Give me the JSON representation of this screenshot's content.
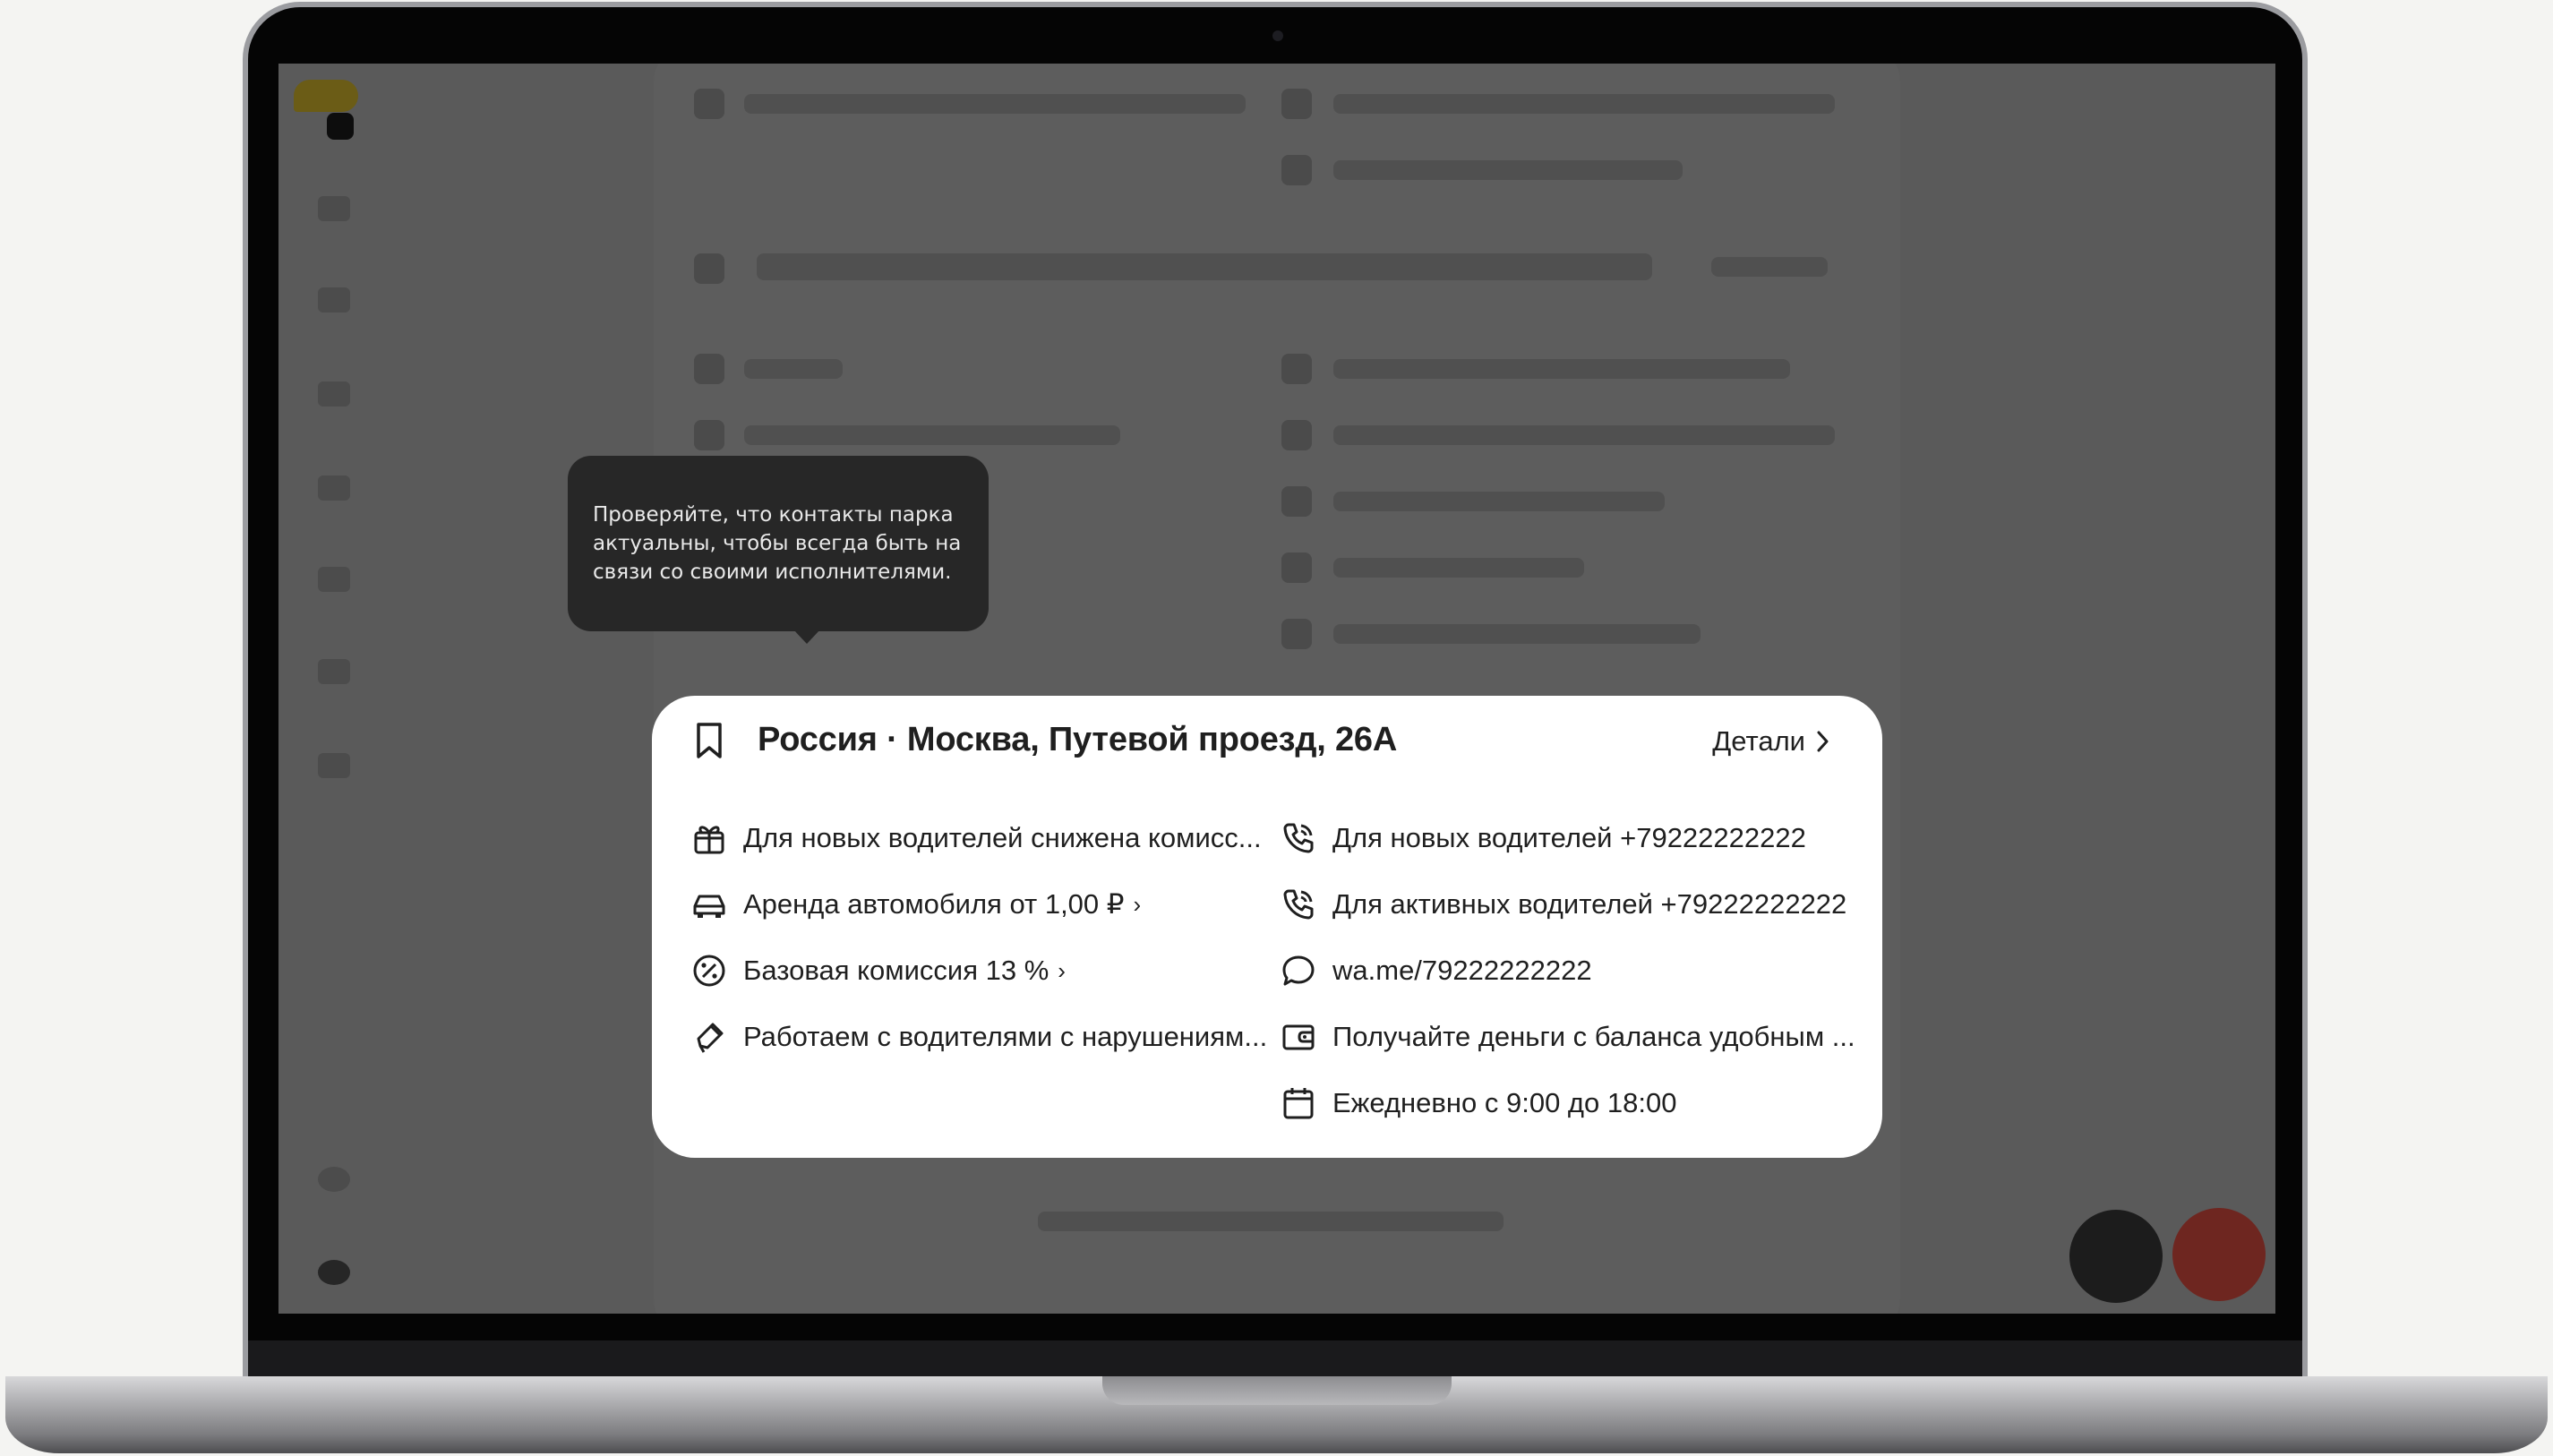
{
  "tooltip": {
    "lines": [
      "Проверяйте, что контакты парка",
      "актуальны, чтобы всегда быть на",
      "связи со своими исполнителями."
    ]
  },
  "card": {
    "title": "Россия · Москва, Путевой проезд, 26А",
    "details_label": "Детали",
    "left_items": [
      {
        "icon": "gift-icon",
        "text": "Для новых водителей снижена комисс...",
        "chevron": ""
      },
      {
        "icon": "car-icon",
        "text": "Аренда автомобиля от 1,00 ₽",
        "chevron": "›"
      },
      {
        "icon": "percent-icon",
        "text": "Базовая комиссия 13 %",
        "chevron": "›"
      },
      {
        "icon": "pen-icon",
        "text": "Работаем с водителями с нарушениям...",
        "chevron": ""
      }
    ],
    "right_items": [
      {
        "icon": "phone-icon",
        "text": "Для новых водителей +79222222222"
      },
      {
        "icon": "phone-icon",
        "text": "Для активных водителей +79222222222"
      },
      {
        "icon": "chat-icon",
        "text": "wa.me/79222222222"
      },
      {
        "icon": "wallet-icon",
        "text": "Получайте деньги с баланса удобным ..."
      },
      {
        "icon": "calendar-icon",
        "text": "Ежедневно с 9:00 до 18:00"
      }
    ]
  },
  "colors": {
    "overlay": "#5a5a5a",
    "tooltip_bg": "#272727",
    "card_bg": "#ffffff",
    "text": "#1f1f1f"
  }
}
